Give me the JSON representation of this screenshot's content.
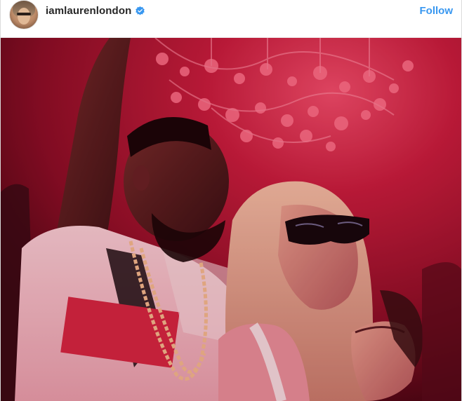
{
  "post": {
    "username": "iamlaurenlondon",
    "verified": true,
    "follow_label": "Follow"
  },
  "icons": {
    "avatar": "profile-avatar",
    "verified": "verified-badge-icon"
  },
  "colors": {
    "follow_blue": "#3897f0",
    "verified_blue": "#3897f0",
    "username_text": "#262626",
    "photo_red": "#c8183a"
  }
}
